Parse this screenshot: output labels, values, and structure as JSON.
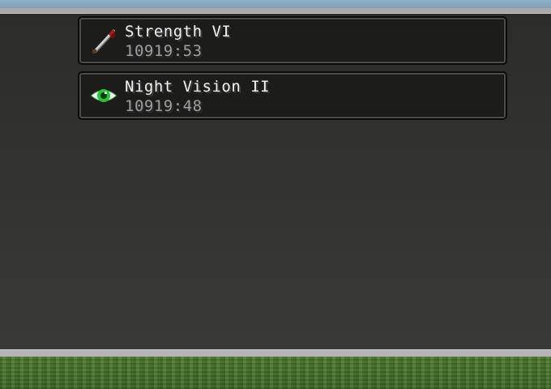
{
  "effects": [
    {
      "name": "Strength VI",
      "duration": "10919:53",
      "icon": "sword-icon",
      "icon_color": "#8b1a1a"
    },
    {
      "name": "Night Vision II",
      "duration": "10919:48",
      "icon": "eye-icon",
      "icon_color": "#2fbf3a"
    }
  ],
  "colors": {
    "panel": "#1c1d1b",
    "background": "#2f302e",
    "name_text": "#f2f2f2",
    "duration_text": "#9e9e9e"
  }
}
